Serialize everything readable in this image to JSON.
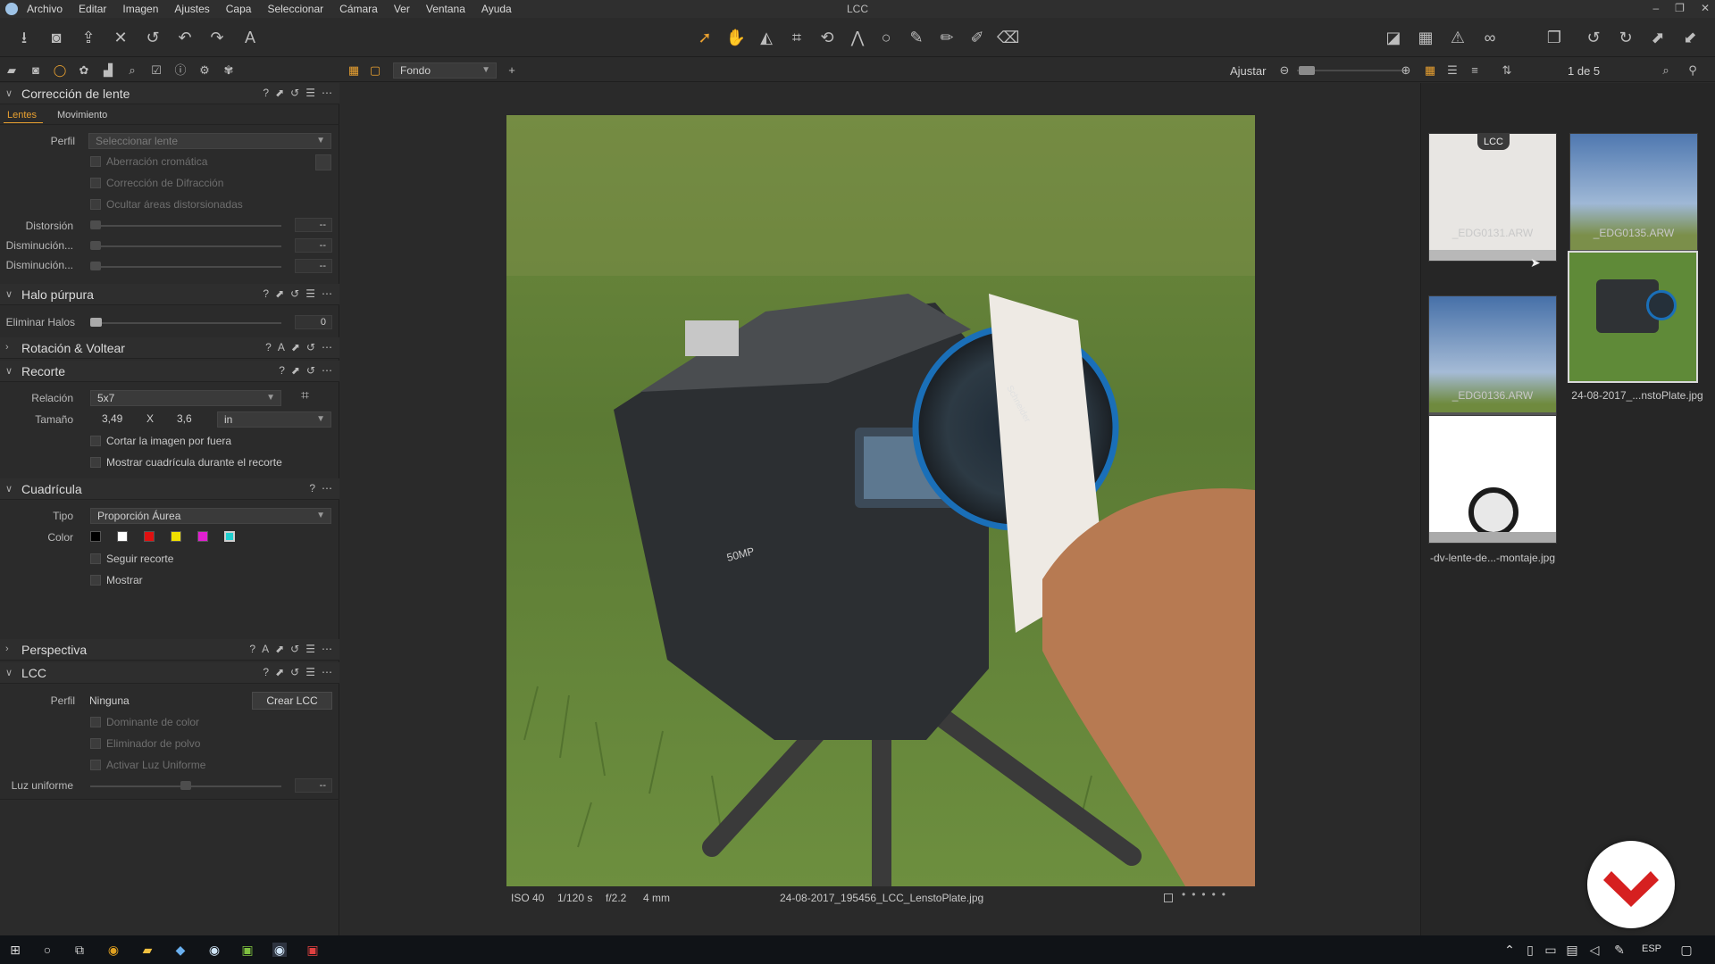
{
  "window": {
    "title": "LCC"
  },
  "menu": [
    "Archivo",
    "Editar",
    "Imagen",
    "Ajustes",
    "Capa",
    "Seleccionar",
    "Cámara",
    "Ver",
    "Ventana",
    "Ayuda"
  ],
  "subbar": {
    "background_select": "Fondo",
    "fit_label": "Ajustar",
    "counter": "1 de 5"
  },
  "panel": {
    "lens": {
      "title": "Corrección de lente",
      "tabs": [
        "Lentes",
        "Movimiento"
      ],
      "profile_label": "Perfil",
      "profile_value": "Seleccionar lente",
      "chk_chromatic": "Aberración cromática",
      "chk_diffraction": "Corrección de Difracción",
      "chk_hide": "Ocultar áreas distorsionadas",
      "distortion_label": "Distorsión",
      "dim1_label": "Disminución...",
      "dim2_label": "Disminución...",
      "dash": "--"
    },
    "halo": {
      "title": "Halo púrpura",
      "remove_label": "Eliminar Halos",
      "remove_value": "0"
    },
    "rotation": {
      "title": "Rotación & Voltear"
    },
    "crop": {
      "title": "Recorte",
      "ratio_label": "Relación",
      "ratio_value": "5x7",
      "size_label": "Tamaño",
      "width": "3,49",
      "x": "X",
      "height": "3,6",
      "unit": "in",
      "chk_outside": "Cortar la imagen por fuera",
      "chk_grid": "Mostrar cuadrícula durante el recorte"
    },
    "grid": {
      "title": "Cuadrícula",
      "type_label": "Tipo",
      "type_value": "Proporción Áurea",
      "color_label": "Color",
      "colors": [
        "#000000",
        "#ffffff",
        "#e01010",
        "#f0e000",
        "#e020d0",
        "#20d0d0"
      ],
      "chk_follow": "Seguir recorte",
      "chk_show": "Mostrar"
    },
    "perspective": {
      "title": "Perspectiva"
    },
    "lcc": {
      "title": "LCC",
      "profile_label": "Perfil",
      "profile_value": "Ninguna",
      "create_btn": "Crear LCC",
      "chk_cast": "Dominante de color",
      "chk_dust": "Eliminador de polvo",
      "chk_uniform": "Activar Luz Uniforme",
      "uniform_label": "Luz uniforme",
      "dash": "--"
    }
  },
  "viewer": {
    "exif": {
      "iso": "ISO 40",
      "shutter": "1/120 s",
      "aperture": "f/2.2",
      "focal": "4 mm",
      "filename": "24-08-2017_195456_LCC_LenstoPlate.jpg"
    },
    "camera_text": {
      "badge": "50MP",
      "lens": "Schneider"
    }
  },
  "browser": {
    "thumbs": [
      {
        "name": "_EDG0131.ARW",
        "badge": "LCC"
      },
      {
        "name": "_EDG0135.ARW"
      },
      {
        "name": "_EDG0136.ARW"
      },
      {
        "name": "24-08-2017_...nstoPlate.jpg"
      },
      {
        "name": "-dv-lente-de...-montaje.jpg"
      }
    ]
  },
  "taskbar": {
    "lang": "ESP"
  }
}
